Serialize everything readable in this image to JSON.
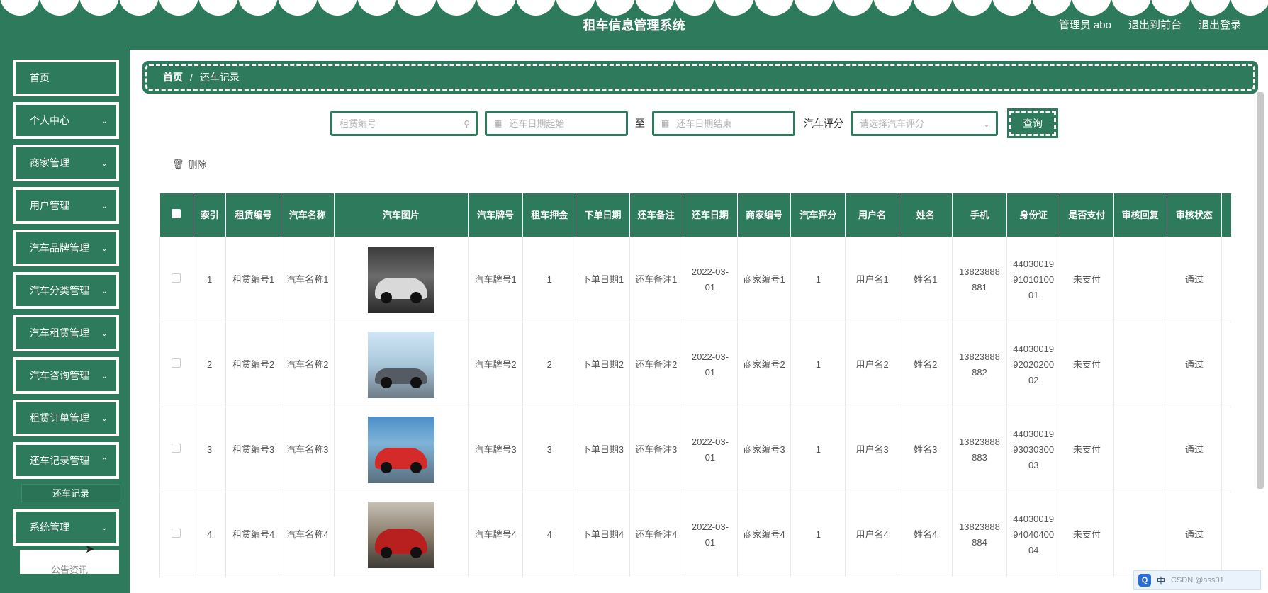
{
  "header": {
    "title": "租车信息管理系统",
    "user_label": "管理员 abo",
    "front_link": "退出到前台",
    "logout_link": "退出登录"
  },
  "sidebar": {
    "items": [
      {
        "label": "首页",
        "has_chevron": false
      },
      {
        "label": "个人中心",
        "has_chevron": true
      },
      {
        "label": "商家管理",
        "has_chevron": true
      },
      {
        "label": "用户管理",
        "has_chevron": true
      },
      {
        "label": "汽车品牌管理",
        "has_chevron": true
      },
      {
        "label": "汽车分类管理",
        "has_chevron": true
      },
      {
        "label": "汽车租赁管理",
        "has_chevron": true
      },
      {
        "label": "汽车咨询管理",
        "has_chevron": true
      },
      {
        "label": "租赁订单管理",
        "has_chevron": true
      },
      {
        "label": "还车记录管理",
        "has_chevron": true
      },
      {
        "label": "系统管理",
        "has_chevron": true
      }
    ],
    "sub_item": "还车记录",
    "partial_item": "公告资讯"
  },
  "breadcrumb": {
    "home": "首页",
    "separator": "/",
    "current": "还车记录"
  },
  "search": {
    "rental_no_placeholder": "租赁编号",
    "date_start_placeholder": "还车日期起始",
    "to_label": "至",
    "date_end_placeholder": "还车日期结束",
    "rating_label": "汽车评分",
    "rating_placeholder": "请选择汽车评分",
    "query_button": "查询"
  },
  "actions": {
    "delete_label": "删除"
  },
  "table": {
    "headers": [
      "",
      "索引",
      "租赁编号",
      "汽车名称",
      "汽车图片",
      "汽车牌号",
      "租车押金",
      "下单日期",
      "还车备注",
      "还车日期",
      "商家编号",
      "汽车评分",
      "用户名",
      "姓名",
      "手机",
      "身份证",
      "是否支付",
      "审核回复",
      "审核状态",
      ""
    ],
    "rows": [
      {
        "index": "1",
        "rental_no": "租赁编号1",
        "car_name": "汽车名称1",
        "plate": "汽车牌号1",
        "deposit": "1",
        "order_date": "下单日期1",
        "remark": "还车备注1",
        "return_date": "2022-03-01",
        "merchant_no": "商家编号1",
        "rating": "1",
        "username": "用户名1",
        "name": "姓名1",
        "phone": "13823888881",
        "id_card": "440300199101010001",
        "paid": "未支付",
        "reply": "",
        "status": "通过"
      },
      {
        "index": "2",
        "rental_no": "租赁编号2",
        "car_name": "汽车名称2",
        "plate": "汽车牌号2",
        "deposit": "2",
        "order_date": "下单日期2",
        "remark": "还车备注2",
        "return_date": "2022-03-01",
        "merchant_no": "商家编号2",
        "rating": "1",
        "username": "用户名2",
        "name": "姓名2",
        "phone": "13823888882",
        "id_card": "440300199202020002",
        "paid": "未支付",
        "reply": "",
        "status": "通过"
      },
      {
        "index": "3",
        "rental_no": "租赁编号3",
        "car_name": "汽车名称3",
        "plate": "汽车牌号3",
        "deposit": "3",
        "order_date": "下单日期3",
        "remark": "还车备注3",
        "return_date": "2022-03-01",
        "merchant_no": "商家编号3",
        "rating": "1",
        "username": "用户名3",
        "name": "姓名3",
        "phone": "13823888883",
        "id_card": "440300199303030003",
        "paid": "未支付",
        "reply": "",
        "status": "通过"
      },
      {
        "index": "4",
        "rental_no": "租赁编号4",
        "car_name": "汽车名称4",
        "plate": "汽车牌号4",
        "deposit": "4",
        "order_date": "下单日期4",
        "remark": "还车备注4",
        "return_date": "2022-03-01",
        "merchant_no": "商家编号4",
        "rating": "1",
        "username": "用户名4",
        "name": "姓名4",
        "phone": "13823888884",
        "id_card": "440300199404040004",
        "paid": "未支付",
        "reply": "",
        "status": "通过"
      }
    ]
  },
  "ime": {
    "mode": "中",
    "watermark": "CSDN @ass01"
  },
  "colors": {
    "primary": "#2d7a5d",
    "background": "#ffffff"
  }
}
